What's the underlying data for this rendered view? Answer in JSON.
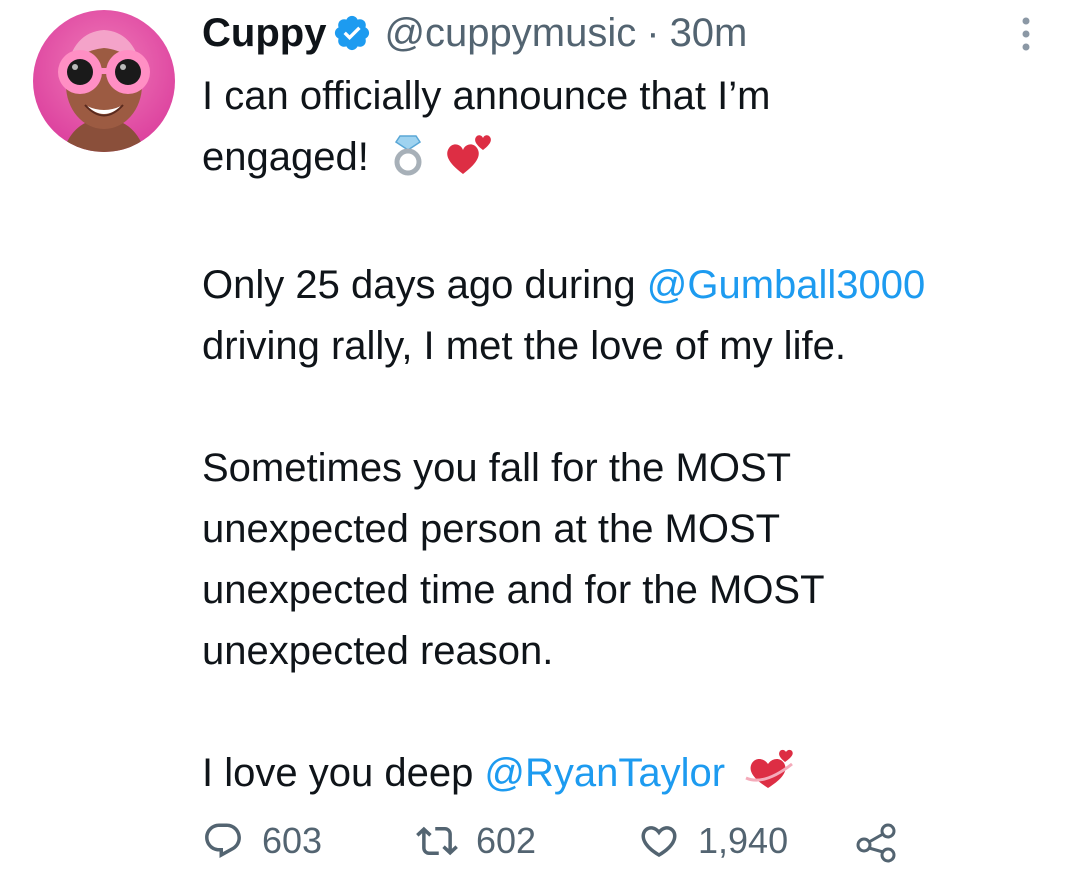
{
  "tweet": {
    "author": {
      "display_name": "Cuppy",
      "handle": "@cuppymusic",
      "verified": true
    },
    "separator": "·",
    "time_ago": "30m",
    "text": {
      "line1": "I can officially announce that I’m",
      "line2": "engaged!",
      "p2_line1_prefix": "Only 25 days ago during ",
      "mention1": "@Gumball3000",
      "p2_line2": "driving rally, I met the love of my life.",
      "p3_line1": "Sometimes you fall for the MOST",
      "p3_line2": "unexpected person at the MOST",
      "p3_line3": "unexpected time and for the MOST",
      "p3_line4": "unexpected reason.",
      "p4_prefix": "I love you deep ",
      "mention2": "@RyanTaylor"
    },
    "emojis": [
      "ring-emoji",
      "two-hearts-emoji",
      "heart-with-ribbon-emoji"
    ],
    "metrics": {
      "replies": "603",
      "retweets": "602",
      "likes": "1,940"
    }
  },
  "colors": {
    "text": "#0f1419",
    "secondary": "#536471",
    "accent": "#1d9bf0",
    "avatar_bg": "#e85aa8"
  }
}
